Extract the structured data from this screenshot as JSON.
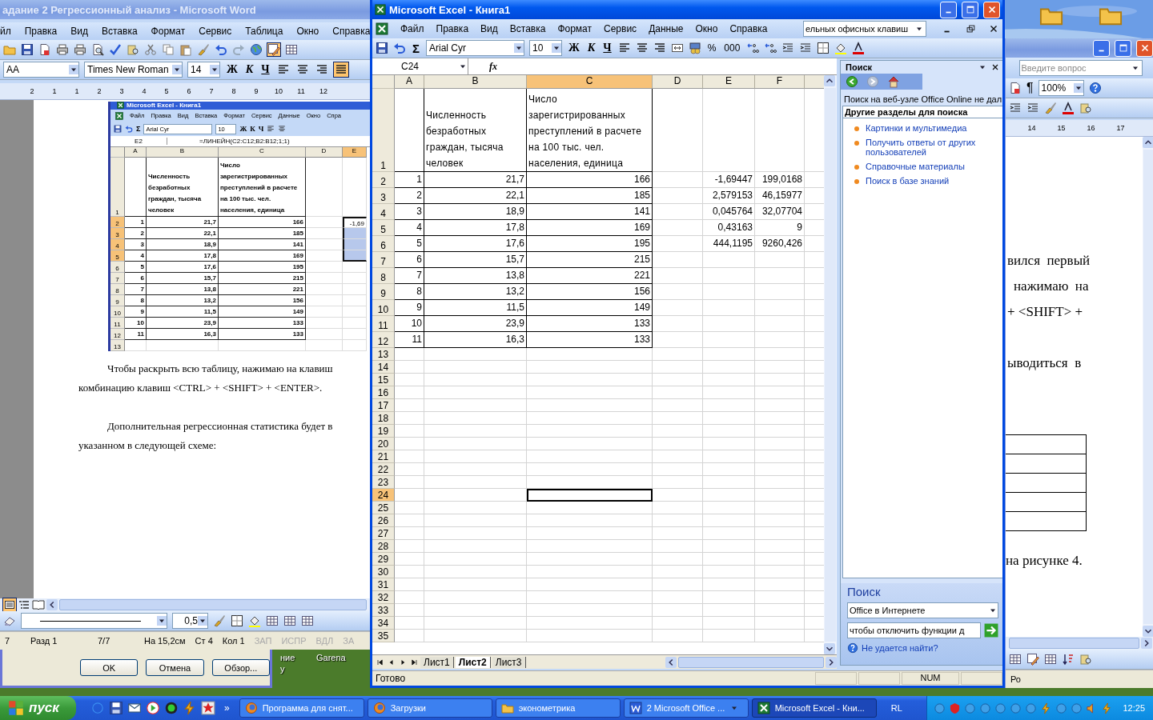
{
  "desktop": {
    "labels": [
      "ние",
      "у",
      "Garena"
    ]
  },
  "word": {
    "title": "адание 2 Регрессионный анализ - Microsoft Word",
    "menu": [
      "йл",
      "Правка",
      "Вид",
      "Вставка",
      "Формат",
      "Сервис",
      "Таблица",
      "Окно",
      "Справка"
    ],
    "style": "AA",
    "font": "Times New Roman",
    "size": "14",
    "glyphs": [
      "Ж",
      "К",
      "Ч"
    ],
    "align_buttons": [
      {
        "selected": false
      },
      {
        "selected": false
      },
      {
        "selected": false
      },
      {
        "selected": true
      }
    ],
    "ruler": [
      "2",
      "1",
      "1",
      "2",
      "3",
      "4",
      "5",
      "6",
      "7",
      "8",
      "9",
      "10",
      "11",
      "12"
    ],
    "embedded_excel": {
      "title": "Microsoft Excel - Книга1",
      "menu": [
        "Файл",
        "Правка",
        "Вид",
        "Вставка",
        "Формат",
        "Сервис",
        "Данные",
        "Окно",
        "Спра"
      ],
      "font": "Arial Cyr",
      "size": "10",
      "glyphs": [
        "Σ",
        "Ж",
        "К",
        "Ч"
      ],
      "name_box": "E2",
      "formula": "=ЛИНЕЙН(C2:C12;B2:B12;1;1)",
      "columns": [
        {
          "label": "A",
          "selected": false
        },
        {
          "label": "B",
          "selected": false
        },
        {
          "label": "C",
          "selected": false
        },
        {
          "label": "D",
          "selected": false
        },
        {
          "label": "E",
          "selected": true
        }
      ],
      "rows": [
        {
          "num": "1",
          "selected": false,
          "cells": [
            null,
            "Численность безработных граждан, тысяча человек",
            "Число зарегистрированных преступлений в расчете на 100 тыс. чел. населения, единица"
          ]
        },
        {
          "num": "2",
          "selected": true,
          "cells": [
            "1",
            "21,7",
            "166",
            null,
            "-1,69"
          ]
        },
        {
          "num": "3",
          "selected": true,
          "cells": [
            "2",
            "22,1",
            "185"
          ]
        },
        {
          "num": "4",
          "selected": true,
          "cells": [
            "3",
            "18,9",
            "141"
          ]
        },
        {
          "num": "5",
          "selected": true,
          "cells": [
            "4",
            "17,8",
            "169"
          ]
        },
        {
          "num": "6",
          "selected": false,
          "cells": [
            "5",
            "17,6",
            "195"
          ]
        },
        {
          "num": "7",
          "selected": false,
          "cells": [
            "6",
            "15,7",
            "215"
          ]
        },
        {
          "num": "8",
          "selected": false,
          "cells": [
            "7",
            "13,8",
            "221"
          ]
        },
        {
          "num": "9",
          "selected": false,
          "cells": [
            "8",
            "13,2",
            "156"
          ]
        },
        {
          "num": "10",
          "selected": false,
          "cells": [
            "9",
            "11,5",
            "149"
          ]
        },
        {
          "num": "11",
          "selected": false,
          "cells": [
            "10",
            "23,9",
            "133"
          ]
        },
        {
          "num": "12",
          "selected": false,
          "cells": [
            "11",
            "16,3",
            "133"
          ]
        },
        {
          "num": "13",
          "selected": false
        }
      ]
    },
    "paragraphs": [
      [
        "Чтобы раскрыть всю таблицу, нажимаю на клавиш",
        "комбинацию клавиш <CTRL> + <SHIFT> + <ENTER>."
      ],
      [
        "Дополнительная регрессионная статистика будет в",
        "указанном в следующей схеме:"
      ]
    ],
    "line_weight": "0,5",
    "status": [
      {
        "text": "7",
        "disabled": false
      },
      {
        "text": "Разд 1",
        "disabled": false
      },
      {
        "text": "7/7",
        "disabled": false
      },
      {
        "text": "На 15,2см",
        "disabled": false
      },
      {
        "text": "Ст 4",
        "disabled": false
      },
      {
        "text": "Кол 1",
        "disabled": false
      },
      {
        "text": "ЗАП",
        "disabled": true
      },
      {
        "text": "ИСПР",
        "disabled": true
      },
      {
        "text": "ВДЛ",
        "disabled": true
      },
      {
        "text": "ЗА",
        "disabled": true
      }
    ]
  },
  "word_right": {
    "placeholder": "Введите вопрос",
    "glyph": "¶",
    "zoom": "100%",
    "ruler": [
      "14",
      "15",
      "16",
      "17"
    ],
    "lines": [
      "вился  первый",
      "нажимаю  на",
      "+ <SHIFT> +",
      "ыводиться  в"
    ],
    "caption": "на рисунке 4.",
    "status_fragment": "Ро"
  },
  "dialog": {
    "buttons": [
      "OK",
      "Отмена",
      "Обзор..."
    ]
  },
  "excel": {
    "title": "Microsoft Excel - Книга1",
    "menu": [
      "Файл",
      "Правка",
      "Вид",
      "Вставка",
      "Формат",
      "Сервис",
      "Данные",
      "Окно",
      "Справка"
    ],
    "help_value": "ельных офисных клавиш",
    "font": "Arial Cyr",
    "size": "10",
    "sigma": "Σ",
    "glyphs": [
      "Ж",
      "К",
      "Ч"
    ],
    "number_glyphs": [
      "%",
      "000"
    ],
    "name_box": "C24",
    "fx": "fx",
    "columns": [
      {
        "label": "A",
        "selected": false
      },
      {
        "label": "B",
        "selected": false
      },
      {
        "label": "C",
        "selected": true
      },
      {
        "label": "D",
        "selected": false
      },
      {
        "label": "E",
        "selected": false
      },
      {
        "label": "F",
        "selected": false
      }
    ],
    "rows": [
      {
        "num": "1",
        "selected": false,
        "cells": [
          null,
          "Численность безработных граждан, тысяча человек",
          "Число зарегистрированных преступлений в расчете на 100 тыс. чел. населения, единица"
        ]
      },
      {
        "num": "2",
        "selected": false,
        "cells": [
          "1",
          "21,7",
          "166",
          null,
          "-1,69447",
          "199,0168"
        ]
      },
      {
        "num": "3",
        "selected": false,
        "cells": [
          "2",
          "22,1",
          "185",
          null,
          "2,579153",
          "46,15977"
        ]
      },
      {
        "num": "4",
        "selected": false,
        "cells": [
          "3",
          "18,9",
          "141",
          null,
          "0,045764",
          "32,07704"
        ]
      },
      {
        "num": "5",
        "selected": false,
        "cells": [
          "4",
          "17,8",
          "169",
          null,
          "0,43163",
          "9"
        ]
      },
      {
        "num": "6",
        "selected": false,
        "cells": [
          "5",
          "17,6",
          "195",
          null,
          "444,1195",
          "9260,426"
        ]
      },
      {
        "num": "7",
        "selected": false,
        "cells": [
          "6",
          "15,7",
          "215"
        ]
      },
      {
        "num": "8",
        "selected": false,
        "cells": [
          "7",
          "13,8",
          "221"
        ]
      },
      {
        "num": "9",
        "selected": false,
        "cells": [
          "8",
          "13,2",
          "156"
        ]
      },
      {
        "num": "10",
        "selected": false,
        "cells": [
          "9",
          "11,5",
          "149"
        ]
      },
      {
        "num": "11",
        "selected": false,
        "cells": [
          "10",
          "23,9",
          "133"
        ]
      },
      {
        "num": "12",
        "selected": false,
        "cells": [
          "11",
          "16,3",
          "133"
        ]
      },
      {
        "num": "13",
        "selected": false
      },
      {
        "num": "14",
        "selected": false
      },
      {
        "num": "15",
        "selected": false
      },
      {
        "num": "16",
        "selected": false
      },
      {
        "num": "17",
        "selected": false
      },
      {
        "num": "18",
        "selected": false
      },
      {
        "num": "19",
        "selected": false
      },
      {
        "num": "20",
        "selected": false
      },
      {
        "num": "21",
        "selected": false
      },
      {
        "num": "22",
        "selected": false
      },
      {
        "num": "23",
        "selected": false
      },
      {
        "num": "24",
        "selected": true
      },
      {
        "num": "25",
        "selected": false
      },
      {
        "num": "26",
        "selected": false
      },
      {
        "num": "27",
        "selected": false
      },
      {
        "num": "28",
        "selected": false
      },
      {
        "num": "29",
        "selected": false
      },
      {
        "num": "30",
        "selected": false
      },
      {
        "num": "31",
        "selected": false
      },
      {
        "num": "32",
        "selected": false
      },
      {
        "num": "33",
        "selected": false
      },
      {
        "num": "34",
        "selected": false
      },
      {
        "num": "35",
        "selected": false
      }
    ],
    "sheets": [
      {
        "label": "Лист1",
        "selected": false
      },
      {
        "label": "Лист2",
        "selected": true
      },
      {
        "label": "Лист3",
        "selected": false
      }
    ],
    "status": "Готово",
    "indicator": "NUM",
    "task_pane": {
      "title": "Поиск",
      "notice": "Поиск на веб-узле Office Online не дал",
      "section": "Другие разделы для поиска",
      "links": [
        "Картинки и мультимедиа",
        "Получить ответы от других пользователей",
        "Справочные материалы",
        "Поиск в базе знаний"
      ],
      "search_title": "Поиск",
      "scope": "Office в Интернете",
      "query": "чтобы отключить функции д",
      "help_link": "Не удается найти?"
    }
  },
  "taskbar": {
    "start": "пуск",
    "more": "»",
    "tasks": [
      {
        "label": "Программа для снят...",
        "kind": "browser",
        "selected": false
      },
      {
        "label": "Загрузки",
        "kind": "browser",
        "selected": false
      },
      {
        "label": "эконометрика",
        "kind": "folder",
        "selected": false
      },
      {
        "label": "2 Microsoft Office ...",
        "kind": "word",
        "selected": false
      },
      {
        "label": "Microsoft Excel - Кни...",
        "kind": "excel",
        "selected": true
      }
    ],
    "language": "RL",
    "clock": "12:25"
  }
}
